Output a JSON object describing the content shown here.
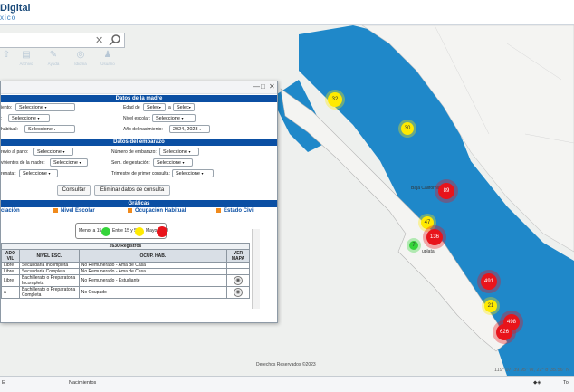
{
  "header": {
    "title": "Digital",
    "subtitle": "xico"
  },
  "search": {
    "value": "",
    "placeholder": ""
  },
  "tools": [
    {
      "label": "",
      "icon": "tool-icon"
    },
    {
      "label": "Archivo",
      "icon": "file-icon"
    },
    {
      "label": "Ayuda",
      "icon": "help-icon"
    },
    {
      "label": "Idioma",
      "icon": "globe-icon"
    },
    {
      "label": "Usuario",
      "icon": "user-icon"
    }
  ],
  "dialog": {
    "controls": [
      "—",
      "□",
      "✕"
    ],
    "madre_title": "Datos de la madre",
    "madre": [
      {
        "label": "iento:",
        "value": "Seleccione"
      },
      {
        "label": "Edad de",
        "value": ""
      },
      {
        "label": ":",
        "value": "Seleccione"
      },
      {
        "label": "Nivel escolar:",
        "value": "Seleccione"
      },
      {
        "label": "habitual:",
        "value": "Seleccione"
      },
      {
        "label": "Año del nacimiento:",
        "value": "2024, 2023"
      }
    ],
    "edad_a": "a",
    "edad_select1": "Selec",
    "edad_select2": "Selec",
    "embarazo_title": "Datos del embarazo",
    "embarazo": [
      {
        "label": "revio al parto:",
        "value": "Seleccione"
      },
      {
        "label": "Número de embarazo:",
        "value": "Seleccione"
      },
      {
        "label": "vivientes de la madre:",
        "value": "Seleccione"
      },
      {
        "label": "Sem. de gestación:",
        "value": "Seleccione"
      },
      {
        "label": "renatal:",
        "value": "Seleccione"
      },
      {
        "label": "Trimestre de primer consulta:",
        "value": "Seleccione"
      }
    ],
    "btn_consultar": "Consultar",
    "btn_eliminar": "Eliminar datos de consulta",
    "graficas_title": "Gráficas",
    "graficas_tabs": [
      "ciación",
      "Nivel Escolar",
      "Ocupación Habitual",
      "Estado Civil"
    ],
    "legend": [
      "Menor a 15",
      "Entre 15 y 50",
      "Mayor a 50"
    ],
    "table": {
      "count": "2630 Registros",
      "headers": [
        "ADO\nVIL",
        "NIVEL ESC.",
        "OCUP. HAB.",
        "VER\nMAPA"
      ],
      "rows": [
        [
          "Libre",
          "Secundaria Incompleta",
          "No Remunerado - Ama de Casa",
          ""
        ],
        [
          "Libre",
          "Secundaria Completa",
          "No Remunerado - Ama de Casa",
          ""
        ],
        [
          "Libre",
          "Bachillerato o Preparatoria Incompleta",
          "No Remunerado - Estudiante",
          "map"
        ],
        [
          "a",
          "Bachillerato o Preparatoria Completa",
          "No Ocupado",
          "map"
        ]
      ]
    }
  },
  "map": {
    "attribution": "Derechos Reservados ©2023",
    "coords": "119° 07' 39.95\" W, 22° 8' 35.56\" N",
    "place_label": "Baja California Sur",
    "place_label2": "uplata",
    "clusters": [
      {
        "value": "32",
        "color": "yellow"
      },
      {
        "value": "30",
        "color": "yellow"
      },
      {
        "value": "89",
        "color": "red"
      },
      {
        "value": "47",
        "color": "yellow"
      },
      {
        "value": "136",
        "color": "red"
      },
      {
        "value": "7",
        "color": "green"
      },
      {
        "value": "491",
        "color": "red"
      },
      {
        "value": "21",
        "color": "yellow"
      },
      {
        "value": "498",
        "color": "red"
      },
      {
        "value": "626",
        "color": "red"
      }
    ]
  },
  "bottom": {
    "left": "E",
    "mid": "Nacimientos",
    "right": "To"
  }
}
